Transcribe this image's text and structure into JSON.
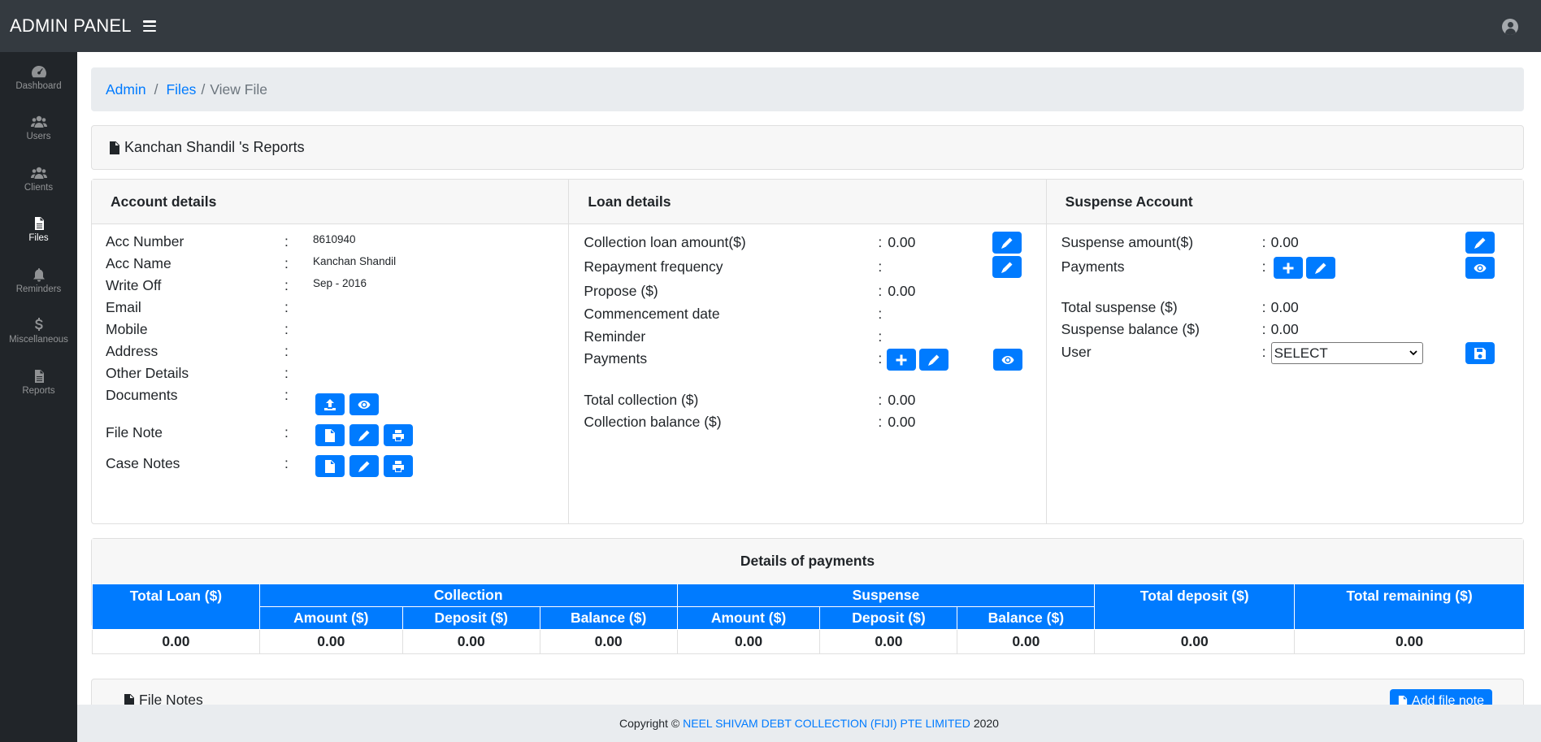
{
  "app": {
    "title": "ADMIN PANEL"
  },
  "sidebar": {
    "items": [
      {
        "label": "Dashboard",
        "icon": "tachometer-icon",
        "active": false
      },
      {
        "label": "Users",
        "icon": "users-icon",
        "active": false
      },
      {
        "label": "Clients",
        "icon": "users-icon",
        "active": false
      },
      {
        "label": "Files",
        "icon": "file-icon",
        "active": true
      },
      {
        "label": "Reminders",
        "icon": "bell-icon",
        "active": false
      },
      {
        "label": "Miscellaneous",
        "icon": "dollar-icon",
        "active": false
      },
      {
        "label": "Reports",
        "icon": "file-icon",
        "active": false
      }
    ]
  },
  "breadcrumb": {
    "admin": "Admin",
    "files": "Files",
    "current": "View File",
    "sep1": "/",
    "sep2": "/"
  },
  "report": {
    "title": "Kanchan Shandil 's Reports"
  },
  "account": {
    "heading": "Account details",
    "colon": ":",
    "acc_number_label": "Acc Number",
    "acc_number": "8610940",
    "acc_name_label": "Acc Name",
    "acc_name": "Kanchan Shandil",
    "write_off_label": "Write Off",
    "write_off": "Sep - 2016",
    "email_label": "Email",
    "mobile_label": "Mobile",
    "address_label": "Address",
    "other_label": "Other Details",
    "documents_label": "Documents",
    "file_note_label": "File Note",
    "case_notes_label": "Case Notes"
  },
  "loan": {
    "heading": "Loan details",
    "collection_amount_label": "Collection loan amount($)",
    "collection_amount": "0.00",
    "repayment_label": "Repayment frequency",
    "propose_label": "Propose ($)",
    "propose": "0.00",
    "commencement_label": "Commencement date",
    "reminder_label": "Reminder",
    "payments_label": "Payments",
    "total_collection_label": "Total collection ($)",
    "total_collection": "0.00",
    "collection_balance_label": "Collection balance ($)",
    "collection_balance": "0.00"
  },
  "suspense": {
    "heading": "Suspense Account",
    "amount_label": "Suspense amount($)",
    "amount": "0.00",
    "payments_label": "Payments",
    "total_label": "Total suspense ($)",
    "total": "0.00",
    "balance_label": "Suspense balance ($)",
    "balance": "0.00",
    "user_label": "User",
    "user_select": "SELECT"
  },
  "payments": {
    "heading": "Details of payments",
    "headers": {
      "total_loan": "Total Loan ($)",
      "collection": "Collection",
      "suspense": "Suspense",
      "total_deposit": "Total deposit ($)",
      "total_remaining": "Total remaining ($)",
      "amount": "Amount ($)",
      "deposit": "Deposit ($)",
      "balance": "Balance ($)"
    },
    "row": [
      "0.00",
      "0.00",
      "0.00",
      "0.00",
      "0.00",
      "0.00",
      "0.00",
      "0.00",
      "0.00"
    ]
  },
  "file_notes": {
    "title": "File Notes",
    "add_button": "Add file note"
  },
  "footer": {
    "prefix": "Copyright ©",
    "company": "NEEL SHIVAM DEBT COLLECTION (FIJI) PTE LIMITED",
    "year": "2020"
  },
  "colors": {
    "primary": "#007bff",
    "topbar": "#343a40",
    "sidebar": "#212529"
  }
}
